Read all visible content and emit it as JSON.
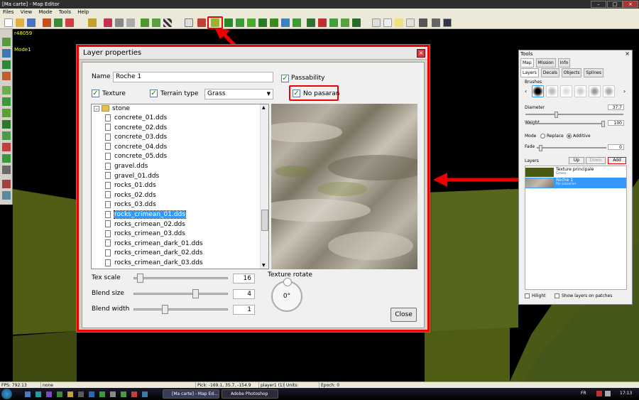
{
  "window": {
    "title": "[Ma carte] - Map Editor"
  },
  "menu": [
    "Files",
    "View",
    "Mode",
    "Tools",
    "Help"
  ],
  "viewport": {
    "stats": "r48059",
    "mode": "Mode1"
  },
  "layer_props": {
    "title": "Layer properties",
    "name_label": "Name",
    "name_value": "Roche 1",
    "passability_label": "Passability",
    "texture_label": "Texture",
    "terrain_type_label": "Terrain type",
    "terrain_type_value": "Grass",
    "no_pasaran_label": "No pasaran",
    "tree_folder": "stone",
    "files": [
      "concrete_01.dds",
      "concrete_02.dds",
      "concrete_03.dds",
      "concrete_04.dds",
      "concrete_05.dds",
      "gravel.dds",
      "gravel_01.dds",
      "rocks_01.dds",
      "rocks_02.dds",
      "rocks_03.dds",
      "rocks_crimean_01.dds",
      "rocks_crimean_02.dds",
      "rocks_crimean_03.dds",
      "rocks_crimean_dark_01.dds",
      "rocks_crimean_dark_02.dds",
      "rocks_crimean_dark_03.dds"
    ],
    "selected_file": "rocks_crimean_01.dds",
    "tex_scale_label": "Tex scale",
    "tex_scale_value": "16",
    "blend_size_label": "Blend size",
    "blend_size_value": "4",
    "blend_width_label": "Blend width",
    "blend_width_value": "1",
    "rotate_label": "Texture rotate",
    "rotate_value": "0°",
    "close_label": "Close"
  },
  "tools": {
    "title": "Tools",
    "tabs_top": [
      "Map",
      "Mission",
      "Info"
    ],
    "tabs_sub": [
      "Layers",
      "Decals",
      "Objects",
      "Splines"
    ],
    "brushes_label": "Brushes",
    "diameter_label": "Diameter",
    "diameter_value": "37.7",
    "weight_label": "Weight",
    "weight_value": "100",
    "mode_label": "Mode",
    "replace_label": "Replace",
    "additive_label": "Additive",
    "fade_label": "Fade",
    "fade_value": "0",
    "layers_label": "Layers",
    "up_label": "Up",
    "down_label": "Down",
    "add_label": "Add",
    "layers": [
      {
        "name": "Texture principale",
        "sub": "Grass"
      },
      {
        "name": "Roche 1",
        "sub": "No pasaran"
      }
    ],
    "hilight_label": "Hilight",
    "show_layers_label": "Show layers on patches"
  },
  "annotation": {
    "number": "1"
  },
  "status": {
    "fps": "FPS: 792.13",
    "sel": "none",
    "pick": "Pick: -169.1, 35.7, -154.9",
    "player": "player1 (1)",
    "units": "Units:",
    "epoch": "Epoch: 0"
  },
  "taskbar": {
    "tasks": [
      "[Ma carte] - Map Ed...",
      "Adobe Photoshop"
    ],
    "lang": "FR",
    "clock": "17:13"
  },
  "colors": {
    "accent": "#e00000",
    "terrain": "#4e5c14",
    "selection": "#3399ff"
  }
}
